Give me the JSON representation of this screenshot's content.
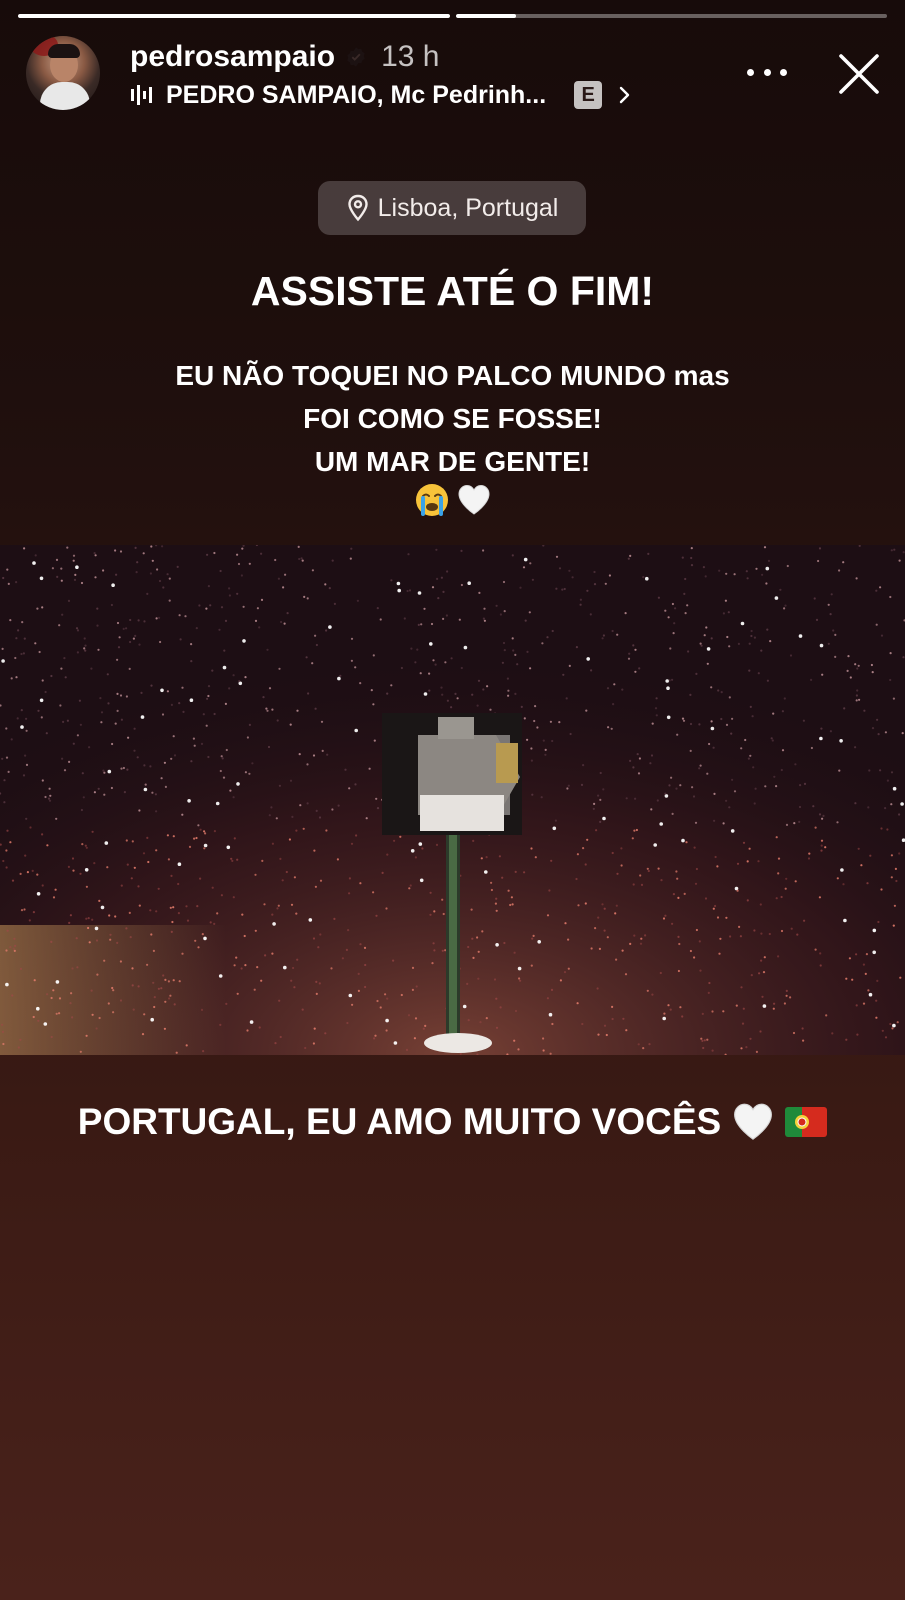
{
  "story": {
    "segments": 2,
    "segment_fill": [
      1.0,
      0.14
    ],
    "colors": {
      "background_top": "#170b0a",
      "background_bottom": "#4a221b",
      "progress_fill": "#ffffff",
      "progress_track": "rgba(255,255,255,0.35)"
    }
  },
  "header": {
    "username": "pedrosampaio",
    "verified_icon": "verified-badge-icon",
    "time_ago": "13 h",
    "music": {
      "icon": "music-bars-icon",
      "label": "PEDRO SAMPAIO, Mc Pedrinh...",
      "explicit_badge": "E",
      "chevron_icon": "chevron-right-icon"
    },
    "more_icon": "more-options-icon",
    "close_icon": "close-icon"
  },
  "location_sticker": {
    "icon": "location-pin-icon",
    "label": "Lisboa, Portugal"
  },
  "texts": {
    "headline": "ASSISTE ATÉ O FIM!",
    "line1": "EU NÃO TOQUEI NO PALCO MUNDO mas",
    "line2": "FOI COMO SE FOSSE!",
    "line3": "UM MAR DE GENTE!",
    "emojis": [
      "crying-face-emoji",
      "white-heart-emoji"
    ],
    "caption": "PORTUGAL, EU AMO MUITO VOCÊS",
    "caption_emojis": [
      "white-heart-emoji",
      "portugal-flag-emoji"
    ]
  }
}
